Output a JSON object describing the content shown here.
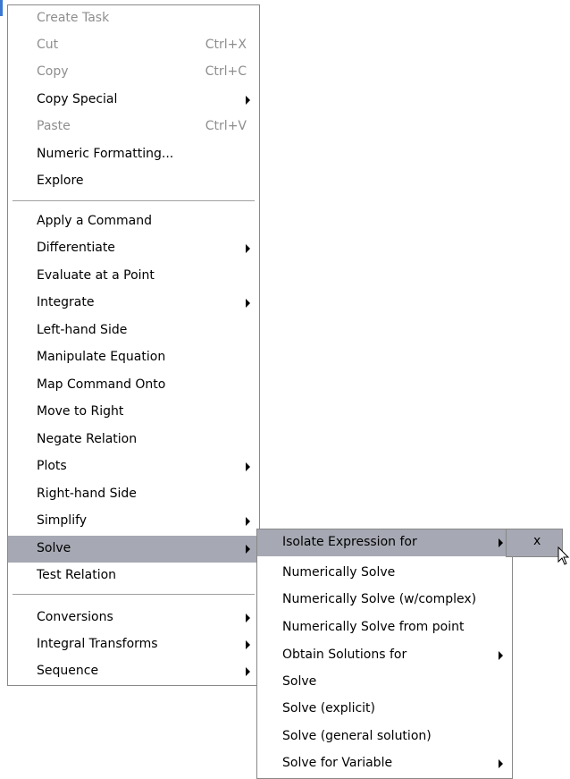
{
  "menu_main": {
    "items": [
      {
        "label": "Create Task",
        "shortcut": "",
        "disabled": true,
        "submenu": false
      },
      {
        "label": "Cut",
        "shortcut": "Ctrl+X",
        "disabled": true,
        "submenu": false
      },
      {
        "label": "Copy",
        "shortcut": "Ctrl+C",
        "disabled": true,
        "submenu": false
      },
      {
        "label": "Copy Special",
        "shortcut": "",
        "disabled": false,
        "submenu": true
      },
      {
        "label": "Paste",
        "shortcut": "Ctrl+V",
        "disabled": true,
        "submenu": false
      },
      {
        "label": "Numeric Formatting...",
        "shortcut": "",
        "disabled": false,
        "submenu": false
      },
      {
        "label": "Explore",
        "shortcut": "",
        "disabled": false,
        "submenu": false
      },
      {
        "label": "Apply a Command",
        "shortcut": "",
        "disabled": false,
        "submenu": false
      },
      {
        "label": "Differentiate",
        "shortcut": "",
        "disabled": false,
        "submenu": true
      },
      {
        "label": "Evaluate at a Point",
        "shortcut": "",
        "disabled": false,
        "submenu": false
      },
      {
        "label": "Integrate",
        "shortcut": "",
        "disabled": false,
        "submenu": true
      },
      {
        "label": "Left-hand Side",
        "shortcut": "",
        "disabled": false,
        "submenu": false
      },
      {
        "label": "Manipulate Equation",
        "shortcut": "",
        "disabled": false,
        "submenu": false
      },
      {
        "label": "Map Command Onto",
        "shortcut": "",
        "disabled": false,
        "submenu": false
      },
      {
        "label": "Move to Right",
        "shortcut": "",
        "disabled": false,
        "submenu": false
      },
      {
        "label": "Negate Relation",
        "shortcut": "",
        "disabled": false,
        "submenu": false
      },
      {
        "label": "Plots",
        "shortcut": "",
        "disabled": false,
        "submenu": true
      },
      {
        "label": "Right-hand Side",
        "shortcut": "",
        "disabled": false,
        "submenu": false
      },
      {
        "label": "Simplify",
        "shortcut": "",
        "disabled": false,
        "submenu": true
      },
      {
        "label": "Solve",
        "shortcut": "",
        "disabled": false,
        "submenu": true,
        "highlighted": true
      },
      {
        "label": "Test Relation",
        "shortcut": "",
        "disabled": false,
        "submenu": false
      },
      {
        "label": "Conversions",
        "shortcut": "",
        "disabled": false,
        "submenu": true
      },
      {
        "label": "Integral Transforms",
        "shortcut": "",
        "disabled": false,
        "submenu": true
      },
      {
        "label": "Sequence",
        "shortcut": "",
        "disabled": false,
        "submenu": true
      }
    ]
  },
  "menu_solve": {
    "items": [
      {
        "label": "Isolate Expression for",
        "submenu": true,
        "highlighted": true
      },
      {
        "label": "Numerically Solve",
        "submenu": false
      },
      {
        "label": "Numerically Solve (w/complex)",
        "submenu": false
      },
      {
        "label": "Numerically Solve from point",
        "submenu": false
      },
      {
        "label": "Obtain Solutions for",
        "submenu": true
      },
      {
        "label": "Solve",
        "submenu": false
      },
      {
        "label": "Solve (explicit)",
        "submenu": false
      },
      {
        "label": "Solve (general solution)",
        "submenu": false
      },
      {
        "label": "Solve for Variable",
        "submenu": true
      }
    ]
  },
  "menu_isolate": {
    "items": [
      {
        "label": "x",
        "highlighted": true
      }
    ]
  },
  "colors": {
    "highlight": "#a6a9b3",
    "disabled_text": "#8e8e8e",
    "separator": "#a0a0a0"
  }
}
